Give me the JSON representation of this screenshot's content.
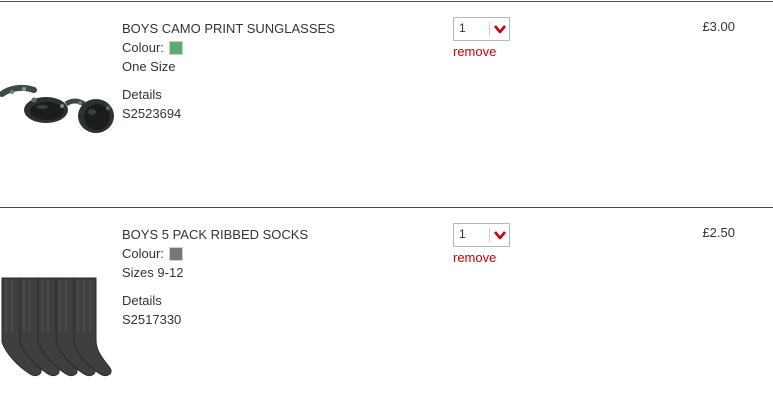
{
  "items": [
    {
      "name": "BOYS CAMO PRINT SUNGLASSES",
      "colour_label": "Colour:",
      "colour_swatch": "#5aab6e",
      "size": "One Size",
      "details_label": "Details",
      "sku": "S2523694",
      "quantity": "1",
      "remove_label": "remove",
      "price": "£3.00",
      "image_icon": "sunglasses-image"
    },
    {
      "name": "BOYS 5 PACK RIBBED SOCKS",
      "colour_label": "Colour:",
      "colour_swatch": "#777777",
      "size": "Sizes 9-12",
      "details_label": "Details",
      "sku": "S2517330",
      "quantity": "1",
      "remove_label": "remove",
      "price": "£2.50",
      "image_icon": "socks-image"
    }
  ],
  "colors": {
    "accent_red": "#cc0000",
    "divider": "#4a4a4a"
  }
}
